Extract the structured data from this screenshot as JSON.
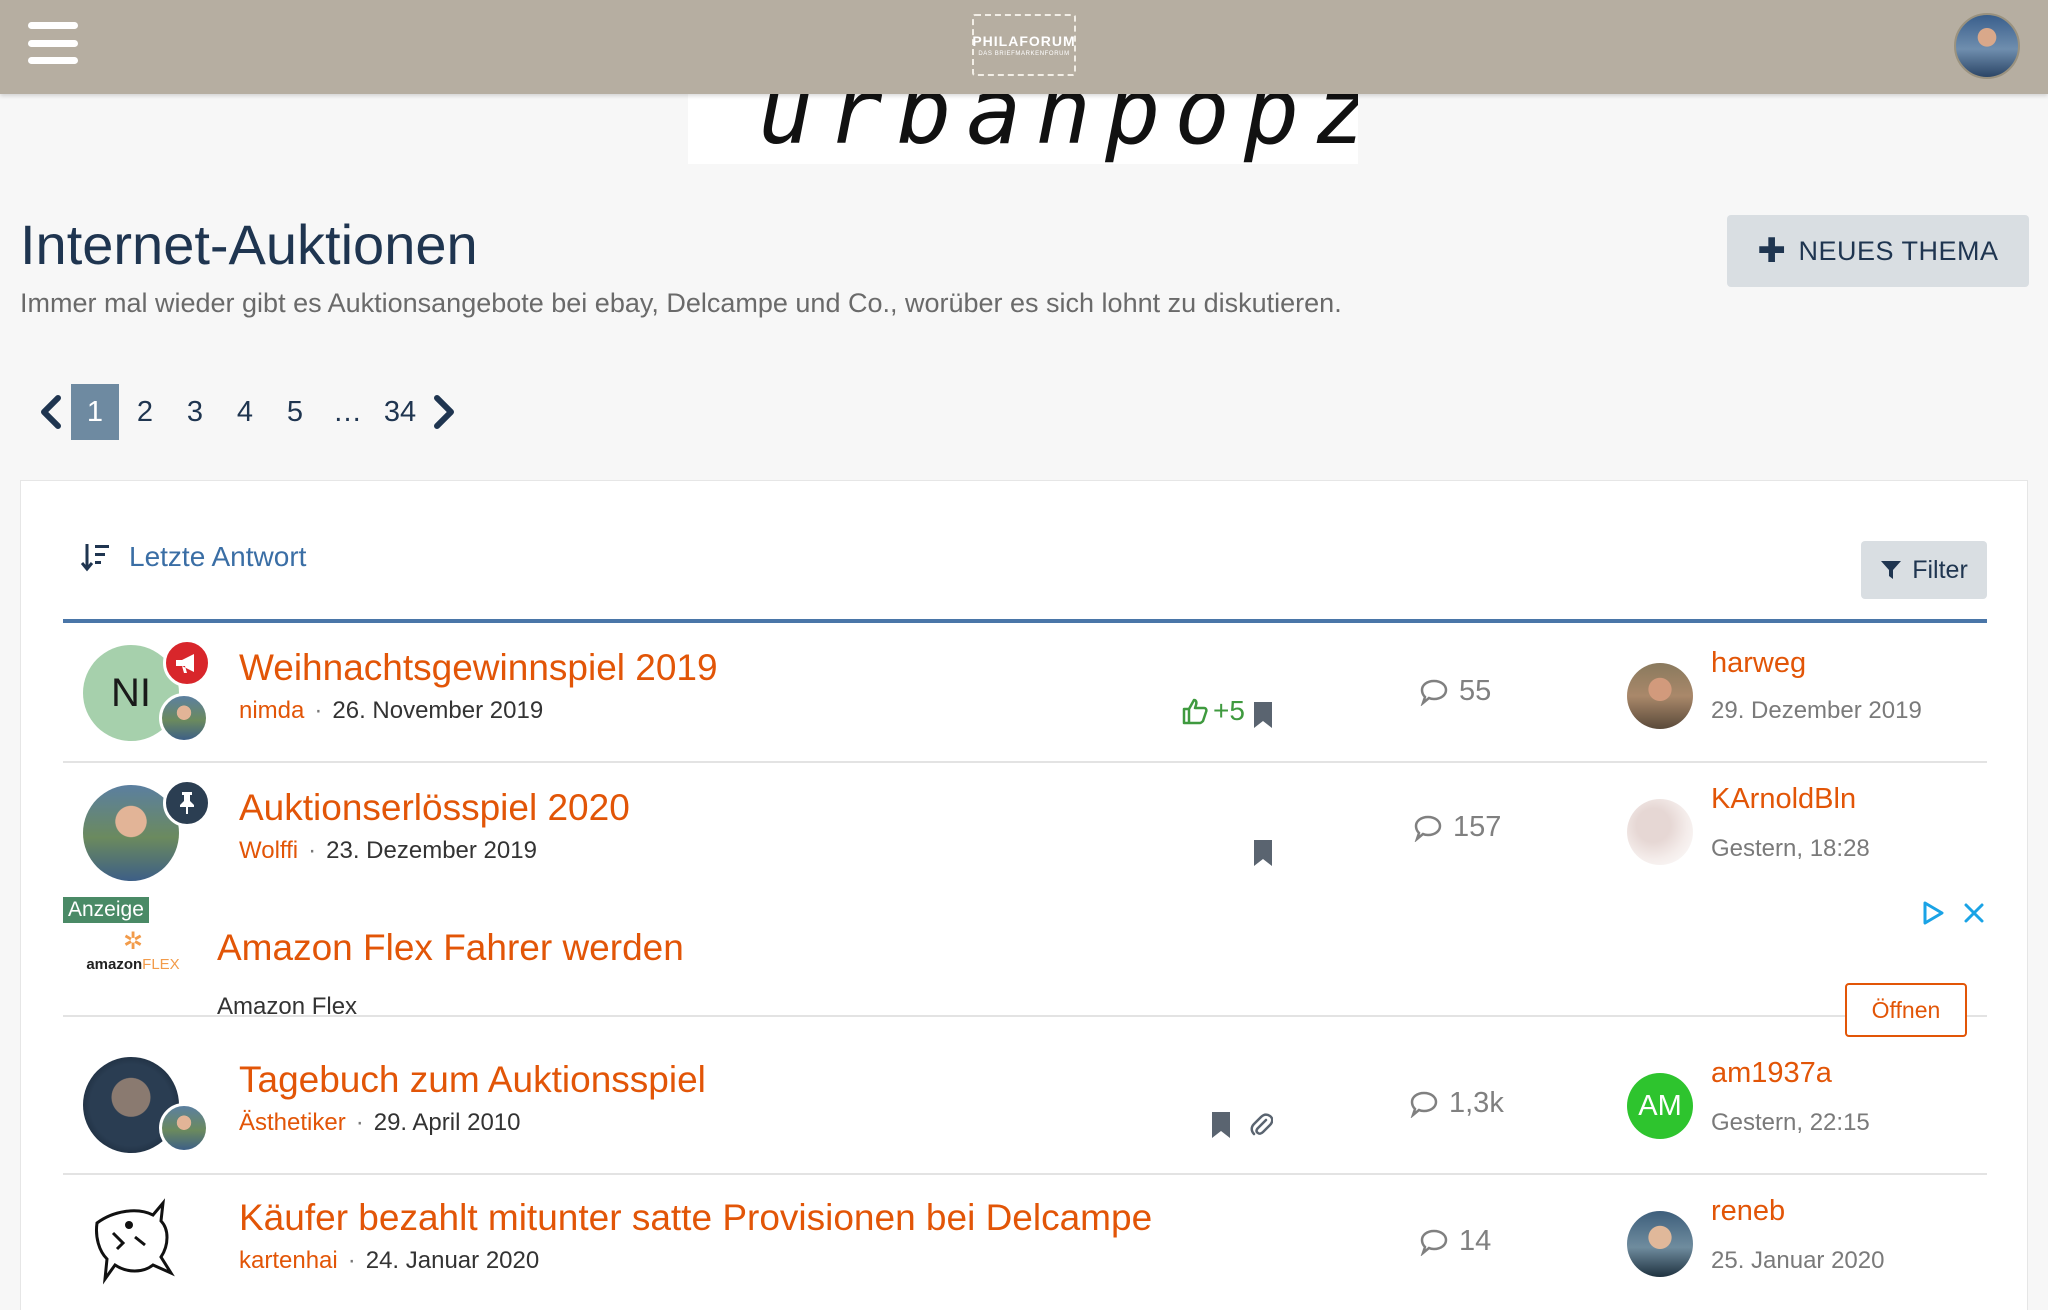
{
  "header": {
    "logo_line1": "PHILAFORUM",
    "logo_line2": "DAS BRIEFMARKENFORUM"
  },
  "banner": {
    "text": "urbanpopz"
  },
  "forum": {
    "title": "Internet-Auktionen",
    "description": "Immer mal wieder gibt es Auktionsangebote bei ebay, Delcampe und Co., worüber es sich lohnt zu diskutieren.",
    "new_thread_label": "NEUES THEMA"
  },
  "pagination": {
    "pages": [
      "1",
      "2",
      "3",
      "4",
      "5"
    ],
    "dots": "…",
    "last": "34",
    "current": 1
  },
  "list": {
    "sort_label": "Letzte Antwort",
    "filter_label": "Filter"
  },
  "threads": [
    {
      "title": "Weihnachtsgewinnspiel 2019",
      "author": "nimda",
      "date": "26. November 2019",
      "avatar_initials": "NI",
      "reactions": "+5",
      "replies": "55",
      "last_user": "harweg",
      "last_time": "29. Dezember 2019"
    },
    {
      "title": "Auktionserlösspiel 2020",
      "author": "Wolffi",
      "date": "23. Dezember 2019",
      "replies": "157",
      "last_user": "KArnoldBln",
      "last_time": "Gestern, 18:28"
    },
    {
      "title": "Tagebuch zum Auktionsspiel",
      "author": "Ästhetiker",
      "date": "29. April 2010",
      "replies": "1,3k",
      "last_user": "am1937a",
      "last_initials": "AM",
      "last_time": "Gestern, 22:15"
    },
    {
      "title": "Käufer bezahlt mitunter satte Provisionen bei Delcampe",
      "author": "kartenhai",
      "date": "24. Januar 2020",
      "replies": "14",
      "last_user": "reneb",
      "last_time": "25. Januar 2020"
    }
  ],
  "ad": {
    "label": "Anzeige",
    "logo_brand": "amazon",
    "logo_product": "FLEX",
    "title": "Amazon Flex Fahrer werden",
    "advertiser": "Amazon Flex",
    "open_label": "Öffnen"
  },
  "colors": {
    "header_bg": "#b6aea1",
    "accent_link": "#e25507",
    "title_blue": "#1f3550",
    "pager_active": "#6e8aa1",
    "separator_blue": "#4a76a8",
    "reaction_green": "#3f9a3f"
  }
}
